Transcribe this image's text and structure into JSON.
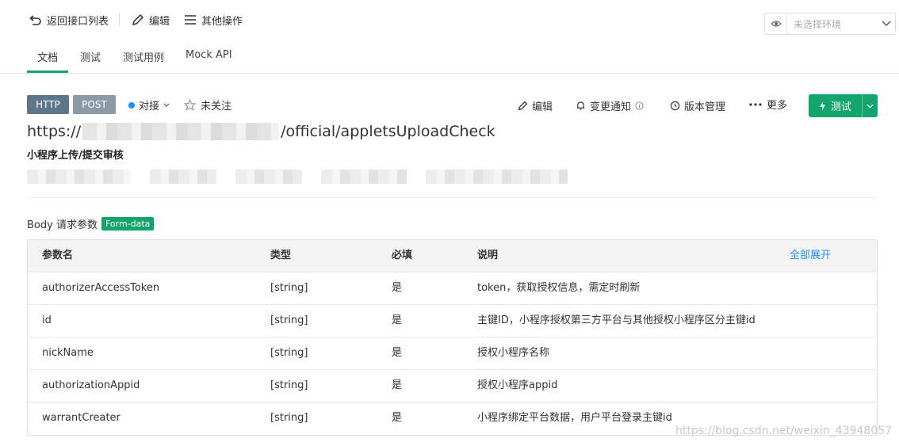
{
  "toolbar": {
    "back_label": "返回接口列表",
    "edit_label": "编辑",
    "more_ops_label": "其他操作",
    "env_placeholder": "未选择环境"
  },
  "tabs": [
    {
      "label": "文档",
      "active": true
    },
    {
      "label": "测试"
    },
    {
      "label": "测试用例"
    },
    {
      "label": "Mock API"
    }
  ],
  "api": {
    "protocol": "HTTP",
    "method": "POST",
    "status": "对接",
    "follow_label": "未关注",
    "url_prefix": "https://",
    "url_suffix": "/official/appletsUploadCheck",
    "name": "小程序上传/提交审核"
  },
  "actions": {
    "edit": "编辑",
    "notify": "变更通知",
    "version": "版本管理",
    "more": "更多",
    "test": "测试"
  },
  "body": {
    "title": "Body 请求参数",
    "format_tag": "Form-data",
    "expand_all": "全部展开",
    "columns": [
      "参数名",
      "类型",
      "必填",
      "说明"
    ],
    "rows": [
      {
        "name": "authorizerAccessToken",
        "type": "[string]",
        "required": "是",
        "desc": "token，获取授权信息，需定时刷新"
      },
      {
        "name": "id",
        "type": "[string]",
        "required": "是",
        "desc": "主键ID，小程序授权第三方平台与其他授权小程序区分主键id"
      },
      {
        "name": "nickName",
        "type": "[string]",
        "required": "是",
        "desc": "授权小程序名称"
      },
      {
        "name": "authorizationAppid",
        "type": "[string]",
        "required": "是",
        "desc": "授权小程序appid"
      },
      {
        "name": "warrantCreater",
        "type": "[string]",
        "required": "是",
        "desc": "小程序绑定平台数据，用户平台登录主键id"
      }
    ]
  },
  "watermark": "https://blog.csdn.net/weixin_43948057",
  "colors": {
    "accent": "#12a46b",
    "link": "#1e90ff",
    "http_badge": "#5e7689",
    "post_badge": "#8c9aa6"
  }
}
